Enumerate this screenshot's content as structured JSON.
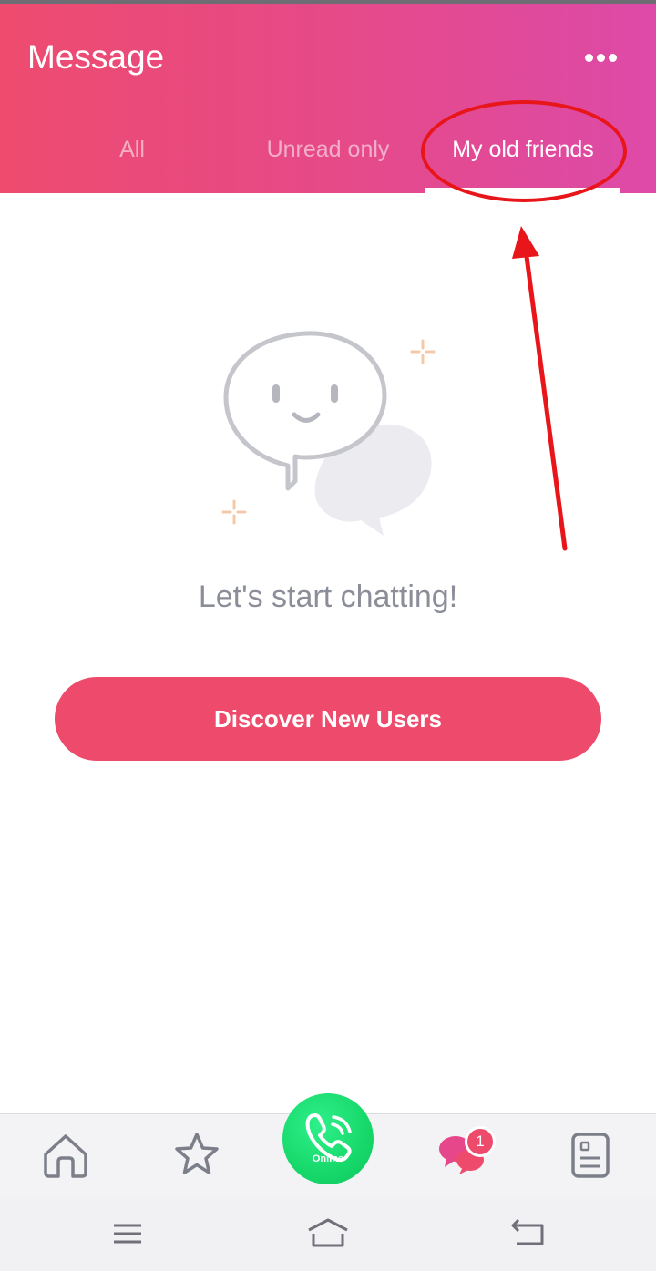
{
  "header": {
    "title": "Message",
    "more_icon": "more-dots-icon"
  },
  "tabs": [
    {
      "label": "All",
      "active": false
    },
    {
      "label": "Unread only",
      "active": false
    },
    {
      "label": "My old friends",
      "active": true
    }
  ],
  "empty_state": {
    "illustration": "smiling-chat-bubble-icon",
    "message": "Let's start chatting!",
    "button_label": "Discover New Users"
  },
  "bottom_nav": {
    "items": [
      {
        "icon": "home-icon"
      },
      {
        "icon": "star-icon"
      },
      {
        "icon": "phone-icon",
        "label": "Online"
      },
      {
        "icon": "chat-icon",
        "badge": "1"
      },
      {
        "icon": "profile-card-icon"
      }
    ]
  },
  "system_nav": {
    "items": [
      {
        "icon": "menu-icon"
      },
      {
        "icon": "home-outline-icon"
      },
      {
        "icon": "back-icon"
      }
    ]
  },
  "colors": {
    "header_start": "#ee4b6f",
    "header_end": "#dd4aa8",
    "primary": "#ee4a6b",
    "online": "#16d86a",
    "annotation": "#e8161a"
  }
}
